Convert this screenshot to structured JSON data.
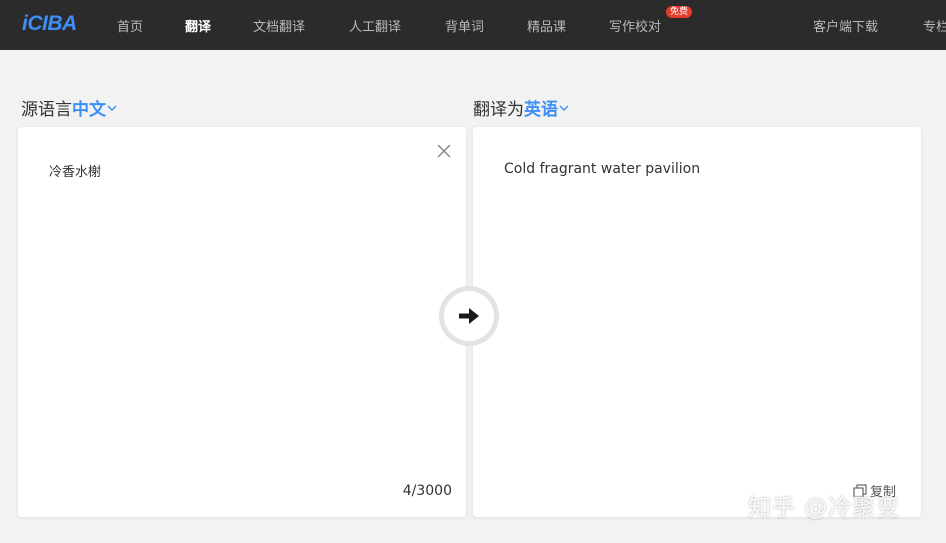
{
  "nav": {
    "logo": "iCIBA",
    "items": [
      {
        "label": "首页"
      },
      {
        "label": "翻译"
      },
      {
        "label": "文档翻译"
      },
      {
        "label": "人工翻译"
      },
      {
        "label": "背单词"
      },
      {
        "label": "精品课"
      },
      {
        "label": "写作校对"
      },
      {
        "label": "客户端下载"
      },
      {
        "label": "专栏"
      }
    ],
    "active_index": 1,
    "free_badge": "免费"
  },
  "source": {
    "lang_prefix": "源语言",
    "lang_value": "中文",
    "text": "冷香水榭",
    "counter": "4/3000",
    "clear_icon": "close-icon"
  },
  "target": {
    "lang_prefix": "翻译为",
    "lang_value": "英语",
    "text": "Cold fragrant water pavilion",
    "copy_label": "复制",
    "copy_icon": "copy-icon"
  },
  "swap_icon": "arrow-right-icon",
  "watermark": "知乎 @冷聚变",
  "colors": {
    "topbar": "#2b2b2b",
    "accent": "#3e8ef7",
    "badge": "#e23c2c",
    "background": "#f2f2f2"
  }
}
